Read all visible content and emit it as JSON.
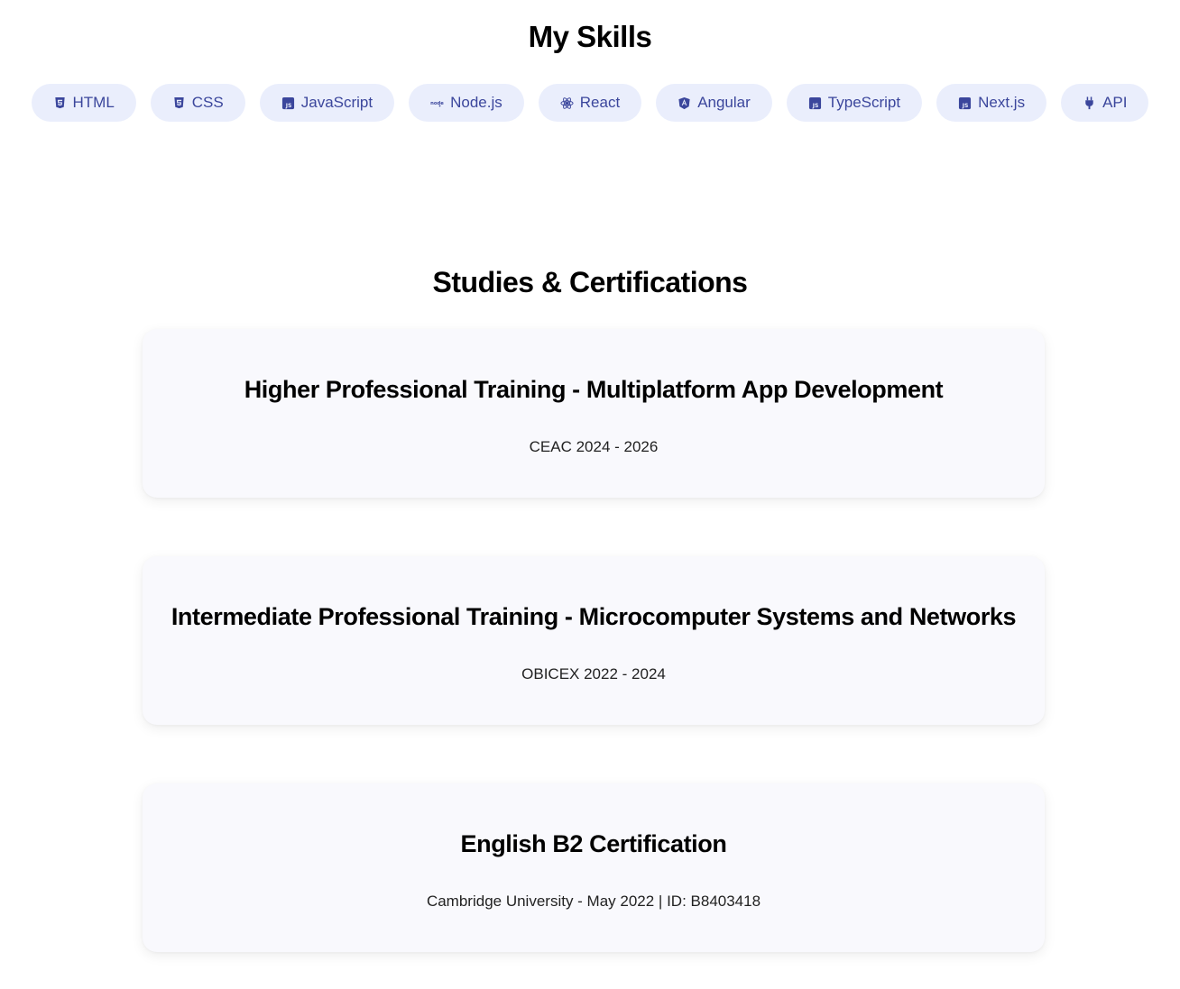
{
  "skills": {
    "title": "My Skills",
    "items": [
      {
        "label": "HTML",
        "icon": "html5-icon"
      },
      {
        "label": "CSS",
        "icon": "css3-icon"
      },
      {
        "label": "JavaScript",
        "icon": "javascript-icon"
      },
      {
        "label": "Node.js",
        "icon": "nodejs-icon"
      },
      {
        "label": "React",
        "icon": "react-icon"
      },
      {
        "label": "Angular",
        "icon": "angular-icon"
      },
      {
        "label": "TypeScript",
        "icon": "javascript-icon"
      },
      {
        "label": "Next.js",
        "icon": "javascript-icon"
      },
      {
        "label": "API",
        "icon": "plug-icon"
      }
    ]
  },
  "studies": {
    "title": "Studies & Certifications",
    "items": [
      {
        "title": "Higher Professional Training - Multiplatform App Development",
        "subtitle": "CEAC 2024 - 2026"
      },
      {
        "title": "Intermediate Professional Training - Microcomputer Systems and Networks",
        "subtitle": "OBICEX 2022 - 2024"
      },
      {
        "title": "English B2 Certification",
        "subtitle": "Cambridge University - May 2022 | ID: B8403418"
      }
    ]
  },
  "colors": {
    "pill_background": "#eaeefc",
    "pill_text": "#3b469c",
    "card_background": "#f9f9fd"
  }
}
